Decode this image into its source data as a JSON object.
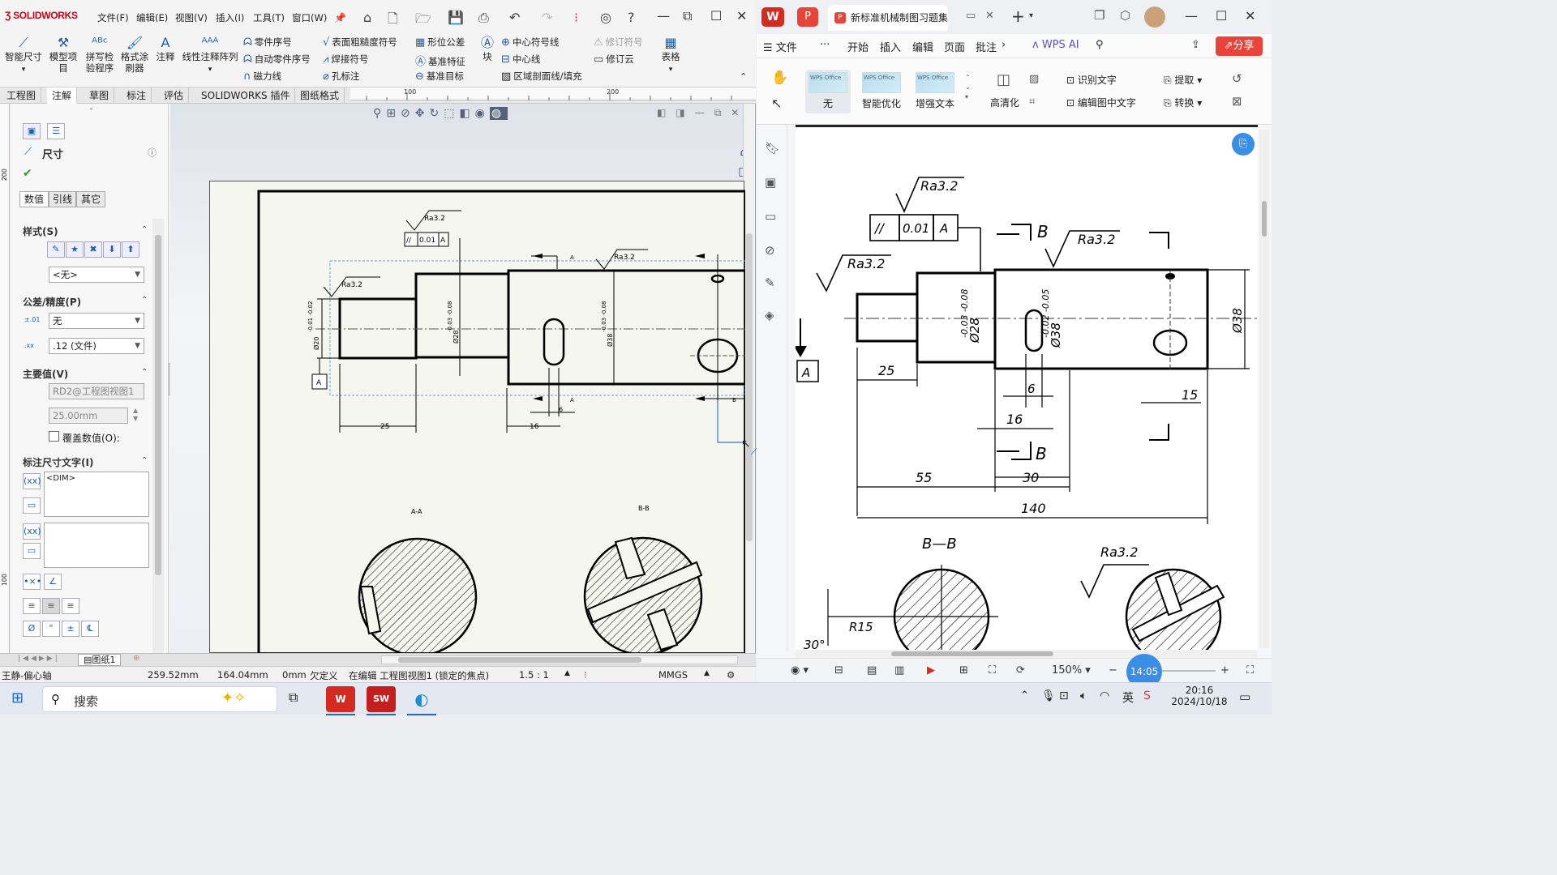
{
  "solidworks": {
    "brand": "SOLIDWORKS",
    "menu": [
      "文件(F)",
      "编辑(E)",
      "视图(V)",
      "插入(I)",
      "工具(T)",
      "窗口(W)"
    ],
    "ribbon": {
      "smart_dimension": "智能尺寸",
      "model_items": "模型项目",
      "spell_check": "拼写检验程序",
      "format_painter": "格式涂刷器",
      "note": "注释",
      "linear_note_pattern": "线性注释阵列",
      "balloon": "零件序号",
      "auto_balloon": "自动零件序号",
      "magnetic_line": "磁力线",
      "surface_finish": "表面粗糙度符号",
      "weld_symbol": "焊接符号",
      "hole_callout": "孔标注",
      "geometric_tolerance": "形位公差",
      "datum_feature": "基准特征",
      "datum_target": "基准目标",
      "block": "块",
      "center_mark": "中心符号线",
      "centerline": "中心线",
      "area_hatch": "区域剖面线/填充",
      "revision_symbol": "修订符号",
      "revision_cloud": "修订云",
      "table": "表格"
    },
    "tabs": [
      "工程图",
      "注解",
      "草图",
      "标注",
      "评估",
      "SOLIDWORKS 插件",
      "图纸格式"
    ],
    "active_tab": "注解",
    "ruler": [
      "100",
      "200"
    ],
    "side_ruler": [
      "200",
      "100"
    ],
    "pm": {
      "title": "尺寸",
      "subtabs": [
        "数值",
        "引线",
        "其它"
      ],
      "style_header": "样式(S)",
      "style_value": "<无>",
      "tolerance_header": "公差/精度(P)",
      "tolerance_value": "无",
      "precision_value": ".12 (文件)",
      "primary_header": "主要值(V)",
      "primary_name": "RD2@工程图视图1",
      "primary_value": "25.00mm",
      "override_label": "覆盖数值(O):",
      "dimtext_header": "标注尺寸文字(I)",
      "dimtext": "<DIM>"
    },
    "sheet_tab": "图纸1",
    "status": {
      "part": "王静-偏心轴",
      "x": "259.52mm",
      "y": "164.04mm",
      "z": "0mm",
      "defined": "欠定义",
      "editing": "在编辑 工程图视图1 (锁定的焦点)",
      "scale": "1.5 : 1",
      "units": "MMGS"
    },
    "drawing": {
      "ra": "Ra3.2",
      "tol_sym": "//",
      "tol_val": "0.01",
      "datum": "A",
      "dim_25": "25",
      "dim_16": "16",
      "dim_6": "6",
      "d20": "Ø20",
      "d20_tol": "-0.01 -0.02",
      "d28": "Ø28",
      "d28_tol": "-0.03 -0.08",
      "d38": "Ø38",
      "d38_tol": "-0.03 -0.08",
      "sec_aa": "A-A",
      "sec_bb": "B-B",
      "cut_a": "A",
      "cut_b": "B"
    }
  },
  "wps": {
    "tab_title": "新标准机械制图习题集（",
    "menu": [
      "文件",
      "开始",
      "插入",
      "编辑",
      "页面",
      "批注"
    ],
    "ai": "WPS AI",
    "share": "分享",
    "enhance": [
      "无",
      "智能优化",
      "增强文本"
    ],
    "thumb_text": "WPS Office",
    "hd": "高清化",
    "ocr": "识别文字",
    "edit_img_text": "编辑图中文字",
    "extract": "提取",
    "convert": "转换",
    "zoom": "150%",
    "time_bubble": "14:05",
    "drawing": {
      "ra": "Ra3.2",
      "tol_sym": "//",
      "tol_val": "0.01",
      "datum": "A",
      "cut": "B",
      "d28": "Ø28",
      "d28_tol": "-0.03 -0.08",
      "d38a": "Ø38",
      "d38a_tol": "-0.02 -0.05",
      "d38b": "Ø38",
      "d25": "25",
      "d6": "6",
      "d16": "16",
      "d15": "15",
      "d55": "55",
      "d30": "30",
      "d140": "140",
      "sec_bb": "B—B",
      "r15": "R15",
      "a30": "30°"
    }
  },
  "taskbar": {
    "search": "搜索",
    "ime": "英",
    "time": "20:16",
    "date": "2024/10/18"
  }
}
